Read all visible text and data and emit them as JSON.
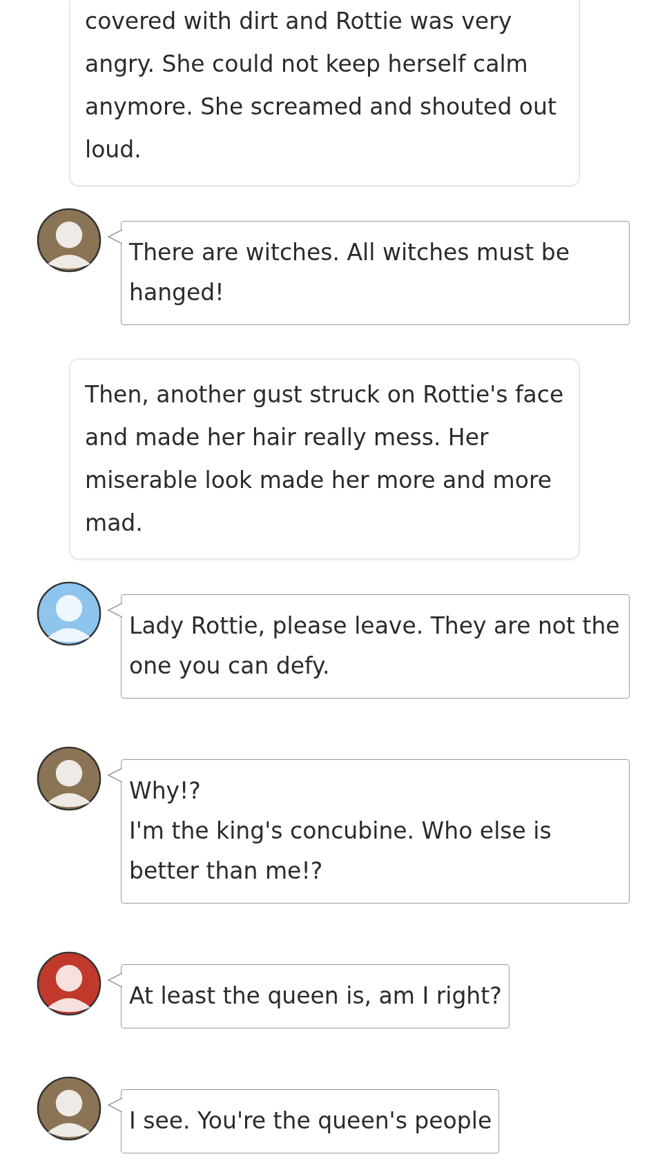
{
  "items": [
    {
      "kind": "narration",
      "text": "covered with dirt and Rottie was very angry. She could not keep herself calm anymore. She screamed and shouted out loud."
    },
    {
      "kind": "chat",
      "avatar": {
        "color": "#8b7355"
      },
      "lines": [
        "There are witches. All witches must be hanged!"
      ]
    },
    {
      "kind": "narration",
      "text": "Then, another gust struck on Rottie's face and made her hair really mess. Her miserable look made her more and more mad."
    },
    {
      "kind": "chat",
      "avatar": {
        "color": "#8ec5ee"
      },
      "lines": [
        "Lady Rottie, please leave. They are not the one you can defy."
      ]
    },
    {
      "kind": "chat",
      "avatar": {
        "color": "#8b7355"
      },
      "lines": [
        "Why!?",
        "I'm the king's concubine. Who else is better than me!?"
      ]
    },
    {
      "kind": "chat",
      "avatar": {
        "color": "#c0392b"
      },
      "lines": [
        "At least the queen is, am I right?"
      ]
    },
    {
      "kind": "chat",
      "avatar": {
        "color": "#8b7355"
      },
      "lines": [
        "I see. You're the queen's people"
      ]
    }
  ]
}
